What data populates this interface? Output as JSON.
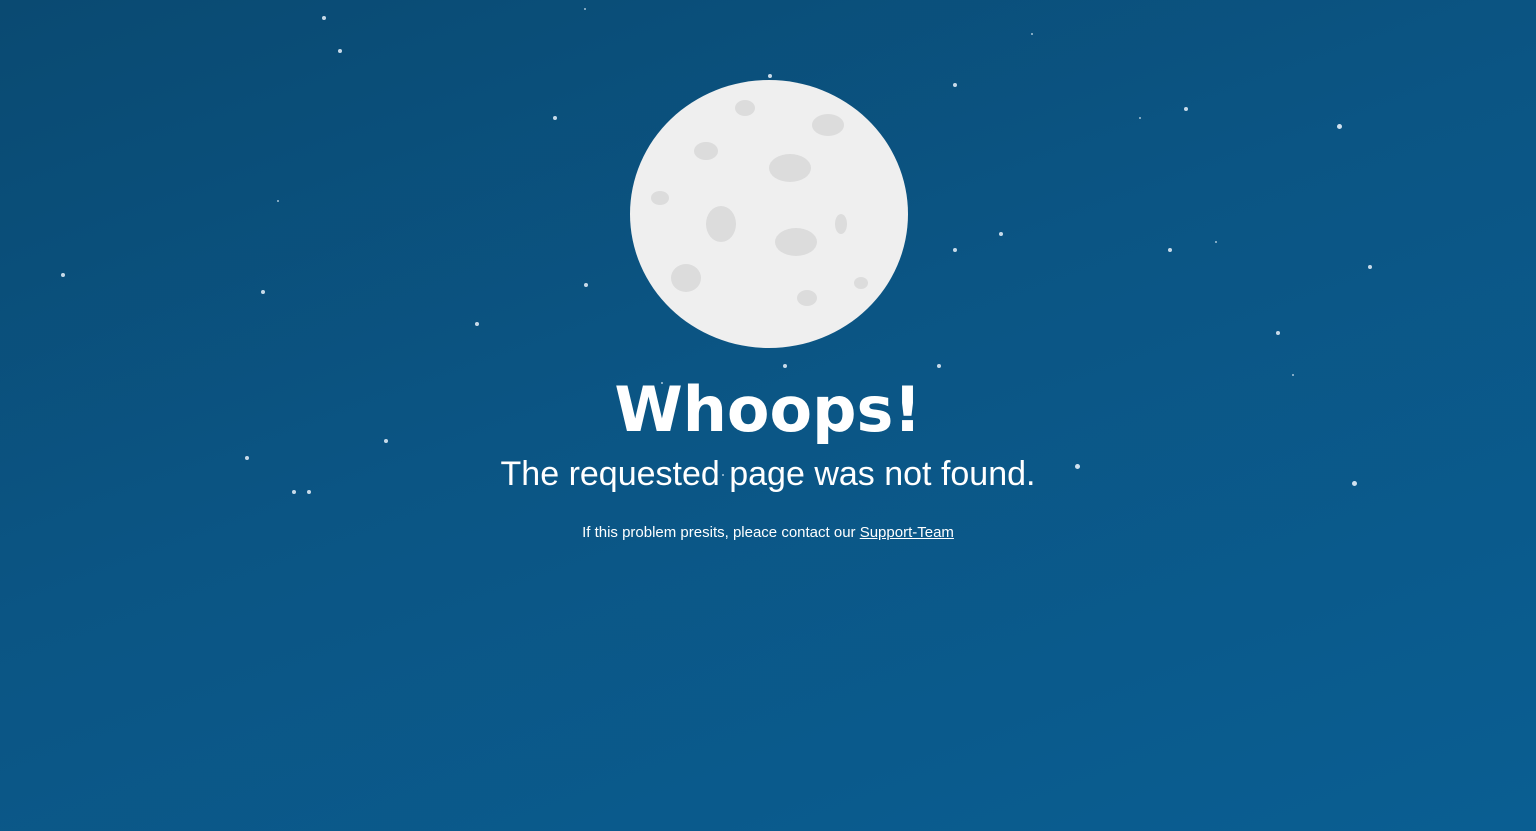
{
  "theme": {
    "background_top": "#0a4a72",
    "background_bottom": "#0a5e92",
    "moon_color": "#efefef",
    "crater_color": "#dcdcdc",
    "star_color": "#dbe9f4"
  },
  "error": {
    "title": "Whoops!",
    "message": "The requested page was not found.",
    "help_text": "If this problem presits, pleace contact our",
    "support_link_label": "Support-Team"
  },
  "illustration": {
    "moon_icon": "moon-icon",
    "stars_icon": "stars-icon"
  }
}
